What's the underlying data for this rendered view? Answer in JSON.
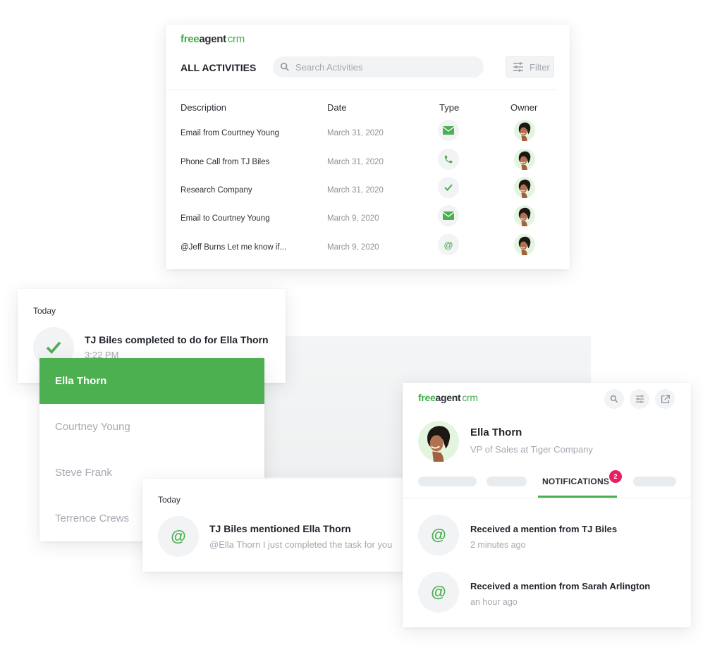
{
  "brand": {
    "part1": "free",
    "part2": "agent",
    "part3": "crm",
    "accent": "#4caf50",
    "badge_color": "#e91e63"
  },
  "activities": {
    "title": "ALL ACTIVITIES",
    "search_placeholder": "Search Activities",
    "filter_label": "Filter",
    "columns": [
      "Description",
      "Date",
      "Type",
      "Owner"
    ],
    "rows": [
      {
        "description": "Email from Courtney Young",
        "date": "March 31, 2020",
        "type": "email-icon"
      },
      {
        "description": "Phone Call from TJ Biles",
        "date": "March 31, 2020",
        "type": "phone-icon"
      },
      {
        "description": "Research Company",
        "date": "March 31, 2020",
        "type": "check-icon"
      },
      {
        "description": "Email to Courtney Young",
        "date": "March 9, 2020",
        "type": "email-icon"
      },
      {
        "description": "@Jeff Burns Let me know if...",
        "date": "March 9, 2020",
        "type": "at-icon"
      }
    ]
  },
  "completed": {
    "section": "Today",
    "title": "TJ Biles completed to do for Ella Thorn",
    "time": "3:22 PM"
  },
  "contacts": {
    "items": [
      {
        "name": "Ella Thorn",
        "active": true
      },
      {
        "name": "Courtney Young",
        "active": false
      },
      {
        "name": "Steve Frank",
        "active": false
      },
      {
        "name": "Terrence Crews",
        "active": false
      }
    ]
  },
  "mention": {
    "section": "Today",
    "title": "TJ Biles mentioned Ella Thorn",
    "preview": "@Ella Thorn I just completed the task for you"
  },
  "profile": {
    "name": "Ella Thorn",
    "role": "VP of Sales at Tiger Company",
    "active_tab": "NOTIFICATIONS",
    "notification_count": "2",
    "notifications": [
      {
        "title": "Received a mention from TJ Biles",
        "time": "2 minutes ago"
      },
      {
        "title": "Received a mention from Sarah Arlington",
        "time": "an hour ago"
      }
    ]
  }
}
